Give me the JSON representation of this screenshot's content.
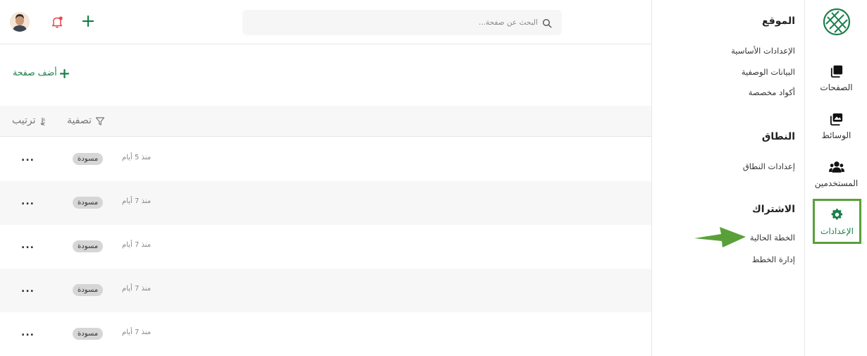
{
  "nav": {
    "items": [
      {
        "label": "الصفحات",
        "icon": "pages-icon"
      },
      {
        "label": "الوسائط",
        "icon": "media-icon"
      },
      {
        "label": "المستخدمين",
        "icon": "users-icon"
      },
      {
        "label": "الإعدادات",
        "icon": "gear-icon"
      }
    ]
  },
  "panel": {
    "site": {
      "title": "الموقع",
      "links": [
        "الإعدادات الأساسية",
        "البيانات الوصفية",
        "أكواد مخصصة"
      ]
    },
    "domain": {
      "title": "النطاق",
      "links": [
        "إعدادات النطاق"
      ]
    },
    "subscription": {
      "title": "الاشتراك",
      "links": [
        "الخطة الحالية",
        "إدارة الخطط"
      ]
    }
  },
  "header": {
    "search_placeholder": "البحث عن صفحة..."
  },
  "main": {
    "add_page": "أضف صفحة",
    "filter": "تصفية",
    "sort": "ترتيب"
  },
  "rows": [
    {
      "time": "منذ 5 أيام",
      "status": "مسودة",
      "menu": "..."
    },
    {
      "time": "منذ 7 أيام",
      "status": "مسودة",
      "menu": "..."
    },
    {
      "time": "منذ 7 أيام",
      "status": "مسودة",
      "menu": "..."
    },
    {
      "time": "منذ 7 أيام",
      "status": "مسودة",
      "menu": "..."
    },
    {
      "time": "منذ 7 أيام",
      "status": "مسودة",
      "menu": "..."
    }
  ],
  "colors": {
    "brand_green": "#1a7f4a",
    "highlight_green": "#5aa039",
    "notification_red": "#e5484d"
  }
}
